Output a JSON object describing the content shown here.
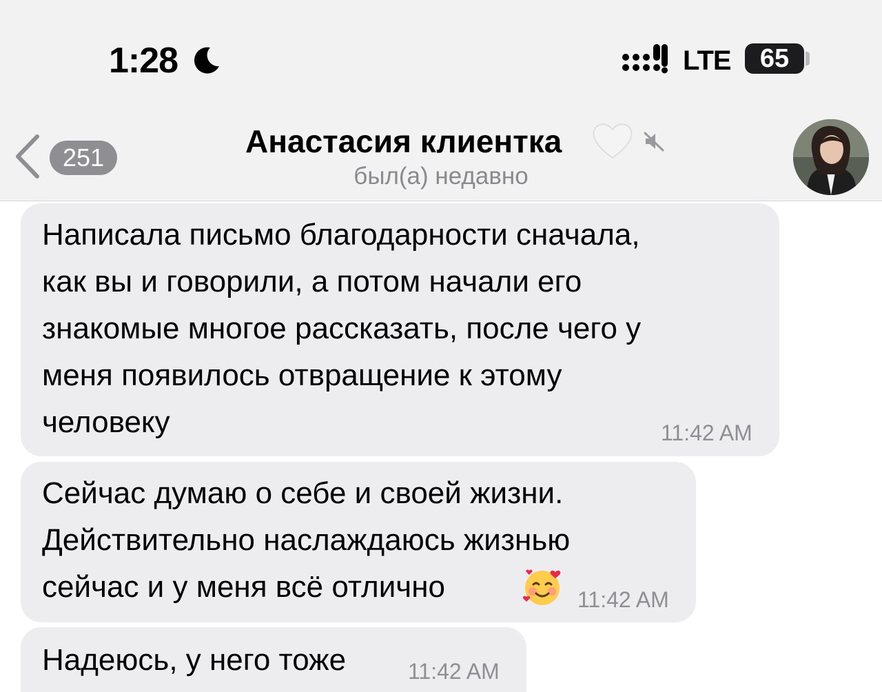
{
  "status_bar": {
    "time": "1:28",
    "network": "LTE",
    "battery": "65",
    "battery_level_percent": 65
  },
  "header": {
    "back_count": "251",
    "contact_name": "Анастасия клиентка",
    "contact_status": "был(а) недавно"
  },
  "messages": [
    {
      "text": "Написала письмо благодарности сначала,\nкак вы и говорили, а потом начали его\nзнакомые многое рассказать, после чего у\nменя появилось отвращение к этому\nчеловеку",
      "time": "11:42 AM"
    },
    {
      "text": "Сейчас думаю о себе и своей жизни.\nДействительно наслаждаюсь жизнью\nсейчас и у меня всё отлично",
      "time": "11:42 AM",
      "emoji": "smiling-face-with-hearts-icon"
    },
    {
      "text": "Надеюсь, у него тоже",
      "time": "11:42 AM"
    }
  ],
  "colors": {
    "header_bg": "#f2f2f3",
    "bubble_bg": "#ededf0",
    "meta_text": "#8e8e93"
  }
}
